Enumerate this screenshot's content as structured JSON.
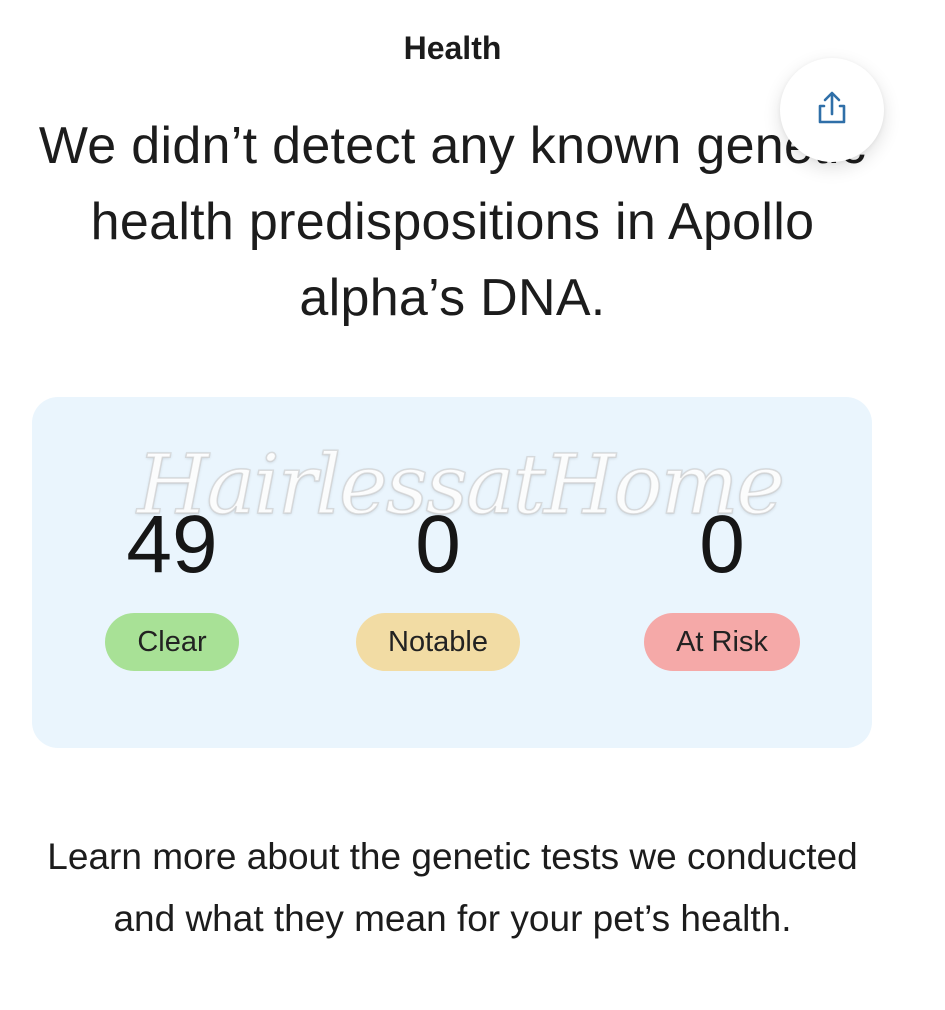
{
  "section": {
    "label": "Health"
  },
  "share": {
    "icon": "share-icon"
  },
  "headline": {
    "text": "We didn’t detect any known genetic health predispositions in Apollo alpha’s DNA."
  },
  "summary": {
    "clear": {
      "count": "49",
      "label": "Clear",
      "color": "#a8e196"
    },
    "notable": {
      "count": "0",
      "label": "Notable",
      "color": "#f2dca4"
    },
    "at_risk": {
      "count": "0",
      "label": "At Risk",
      "color": "#f5a9a8"
    },
    "background": "#eaf5fd"
  },
  "watermark": {
    "text": "HairlessatHome"
  },
  "learn_more": {
    "text": "Learn more about the genetic tests we conducted and what they mean for your pet’s health."
  }
}
